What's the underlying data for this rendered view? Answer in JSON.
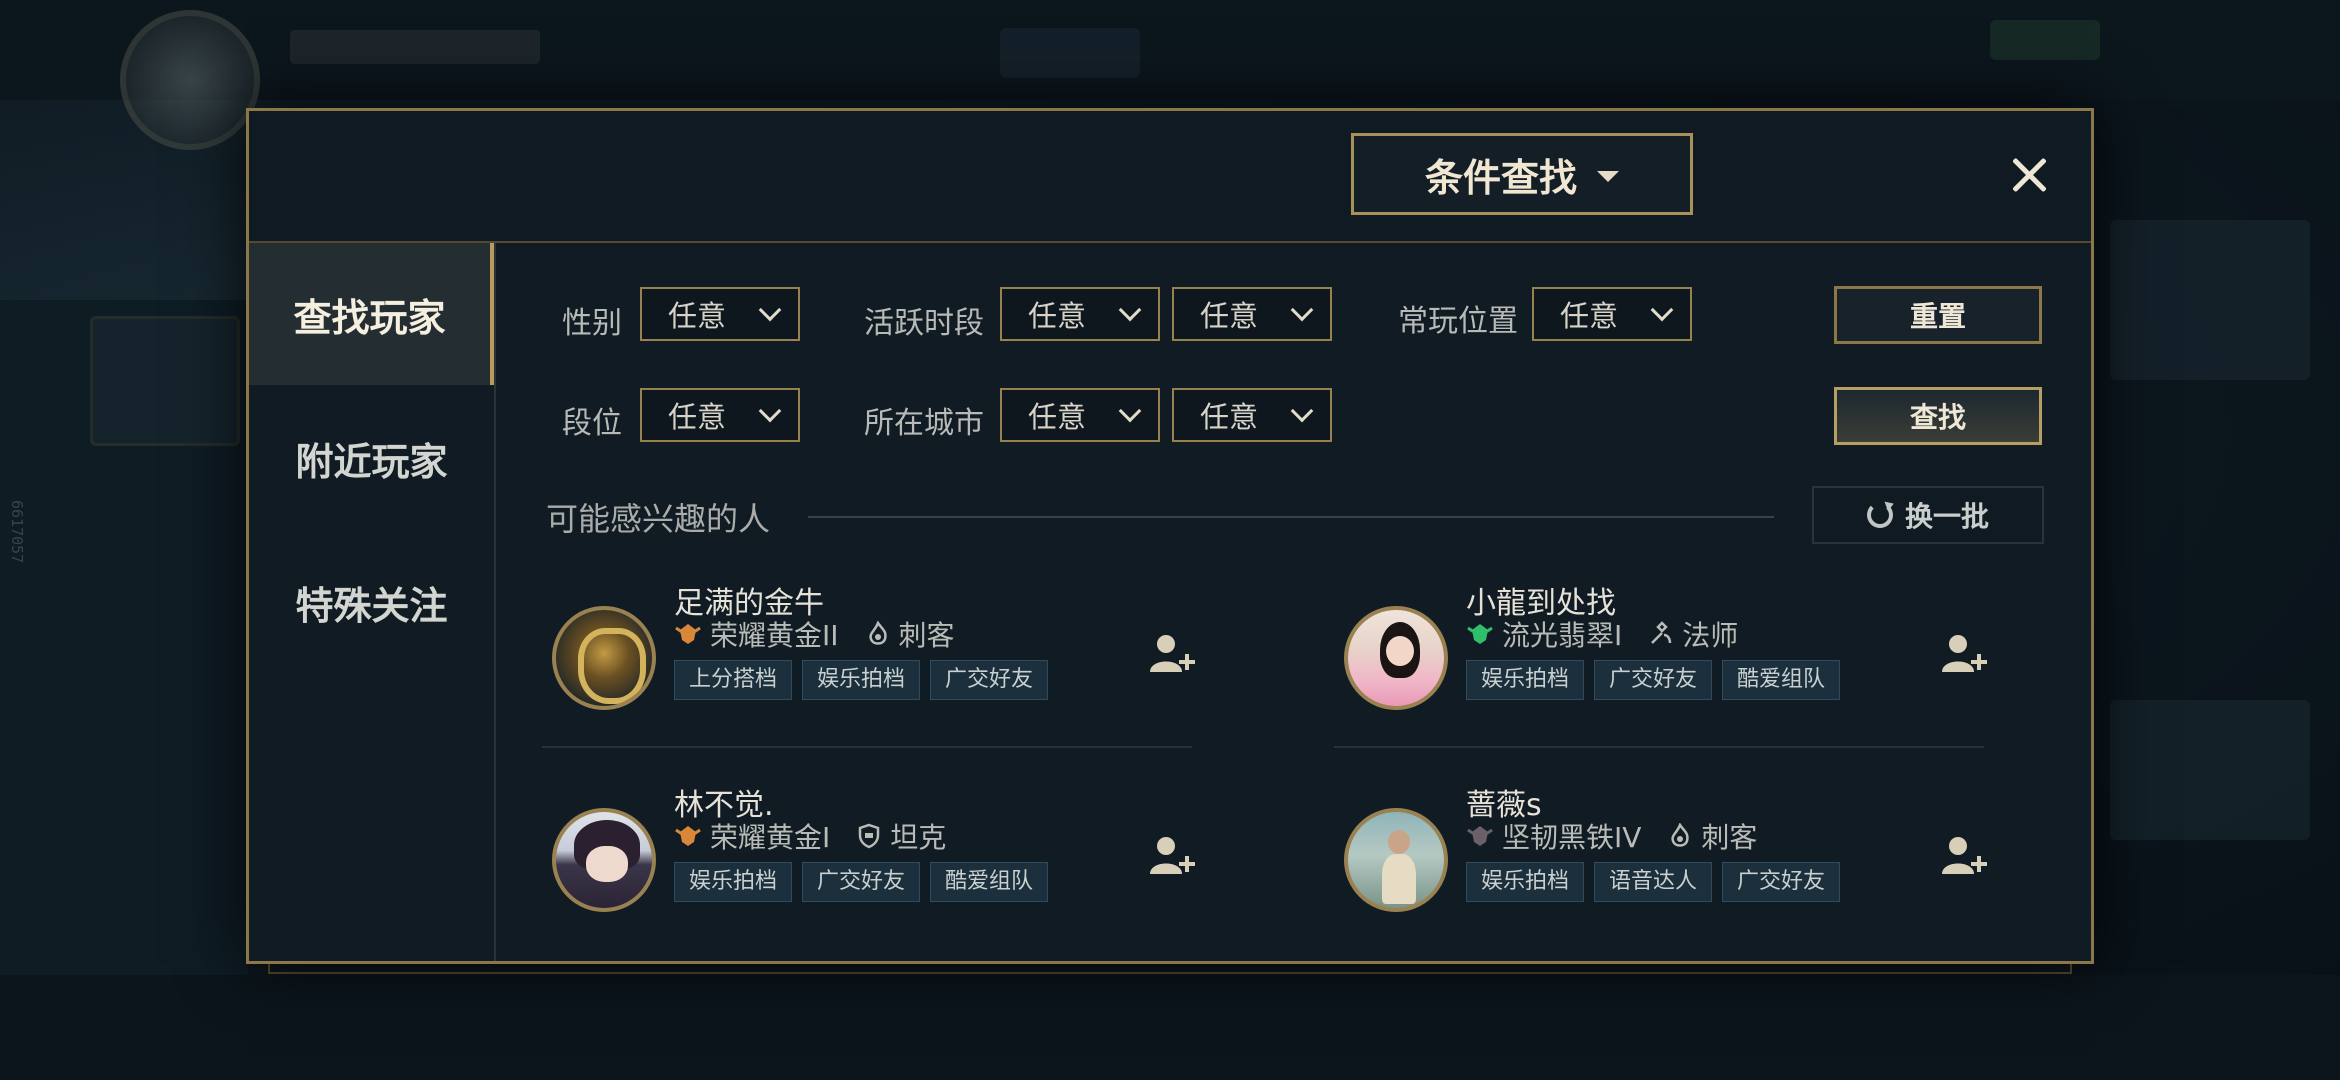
{
  "modal": {
    "search_mode_label": "条件查找",
    "close_label": "关闭"
  },
  "tabs": [
    {
      "label": "查找玩家",
      "active": true
    },
    {
      "label": "附近玩家",
      "active": false
    },
    {
      "label": "特殊关注",
      "active": false
    }
  ],
  "filters": {
    "gender": {
      "label": "性别",
      "value": "任意"
    },
    "active_time": {
      "label": "活跃时段",
      "values": [
        "任意",
        "任意"
      ]
    },
    "position": {
      "label": "常玩位置",
      "value": "任意"
    },
    "rank": {
      "label": "段位",
      "value": "任意"
    },
    "city": {
      "label": "所在城市",
      "values": [
        "任意",
        "任意"
      ]
    },
    "reset_label": "重置",
    "search_label": "查找"
  },
  "suggestions": {
    "title": "可能感兴趣的人",
    "refresh_label": "换一批",
    "players": [
      {
        "name": "足满的金牛",
        "rank": "荣耀黄金II",
        "rank_color": "#d9883a",
        "role": "刺客",
        "role_icon": "assassin-icon",
        "tags": [
          "上分搭档",
          "娱乐拍档",
          "广交好友"
        ]
      },
      {
        "name": "小龍到处找",
        "rank": "流光翡翠I",
        "rank_color": "#2fbf6a",
        "role": "法师",
        "role_icon": "mage-icon",
        "tags": [
          "娱乐拍档",
          "广交好友",
          "酷爱组队"
        ]
      },
      {
        "name": "林不觉.",
        "rank": "荣耀黄金I",
        "rank_color": "#d9883a",
        "role": "坦克",
        "role_icon": "tank-icon",
        "tags": [
          "娱乐拍档",
          "广交好友",
          "酷爱组队"
        ]
      },
      {
        "name": "蔷薇s",
        "rank": "坚韧黑铁IV",
        "rank_color": "#6b5f6a",
        "role": "刺客",
        "role_icon": "assassin-icon",
        "tags": [
          "娱乐拍档",
          "语音达人",
          "广交好友"
        ]
      }
    ]
  },
  "background": {
    "side_code": "6617057"
  }
}
